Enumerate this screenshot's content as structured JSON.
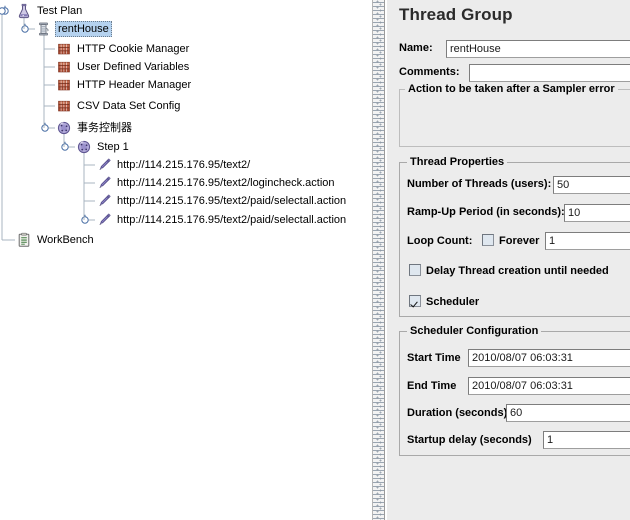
{
  "app": {
    "tree_panel_name": "test-plan-tree",
    "properties_panel_name": "thread-group-properties"
  },
  "tree": {
    "nodes": [
      {
        "label": "Test Plan",
        "icon": "test-plan-flask-icon",
        "depth": 0,
        "selected": false,
        "expanded": true,
        "name": "tree-node-test-plan"
      },
      {
        "label": "rentHouse",
        "icon": "thread-group-spool-icon",
        "depth": 1,
        "selected": true,
        "expanded": true,
        "name": "tree-node-rent-house"
      },
      {
        "label": "HTTP Cookie Manager",
        "icon": "config-element-icon",
        "depth": 2,
        "selected": false,
        "expanded": false,
        "name": "tree-node-http-cookie-manager"
      },
      {
        "label": "User Defined Variables",
        "icon": "config-element-icon",
        "depth": 2,
        "selected": false,
        "expanded": false,
        "name": "tree-node-user-defined-variables"
      },
      {
        "label": "HTTP Header Manager",
        "icon": "config-element-icon",
        "depth": 2,
        "selected": false,
        "expanded": false,
        "name": "tree-node-http-header-manager"
      },
      {
        "label": "CSV Data Set Config",
        "icon": "config-element-icon",
        "depth": 2,
        "selected": false,
        "expanded": false,
        "name": "tree-node-csv-data-set-config"
      },
      {
        "label": "事务控制器",
        "icon": "transaction-controller-icon",
        "depth": 2,
        "selected": false,
        "expanded": true,
        "name": "tree-node-transaction-controller"
      },
      {
        "label": "Step 1",
        "icon": "transaction-controller-icon",
        "depth": 3,
        "selected": false,
        "expanded": true,
        "name": "tree-node-step-1"
      },
      {
        "label": "http://114.215.176.95/text2/",
        "icon": "http-sampler-pen-icon",
        "depth": 4,
        "selected": false,
        "expanded": false,
        "name": "tree-node-sampler-root"
      },
      {
        "label": "http://114.215.176.95/text2/logincheck.action",
        "icon": "http-sampler-pen-icon",
        "depth": 4,
        "selected": false,
        "expanded": false,
        "name": "tree-node-sampler-logincheck"
      },
      {
        "label": "http://114.215.176.95/text2/paid/selectall.action",
        "icon": "http-sampler-pen-icon",
        "depth": 4,
        "selected": false,
        "expanded": false,
        "name": "tree-node-sampler-selectall-1"
      },
      {
        "label": "http://114.215.176.95/text2/paid/selectall.action",
        "icon": "http-sampler-pen-icon",
        "depth": 4,
        "selected": false,
        "expanded": true,
        "name": "tree-node-sampler-selectall-2"
      },
      {
        "label": "WorkBench",
        "icon": "workbench-clipboard-icon",
        "depth": 0,
        "selected": false,
        "expanded": false,
        "name": "tree-node-workbench"
      }
    ]
  },
  "properties": {
    "title": "Thread Group",
    "name_label": "Name:",
    "name_value": "rentHouse",
    "comments_label": "Comments:",
    "comments_value": "",
    "sampler_error_title": "Action to be taken after a Sampler error",
    "thread_properties": {
      "title": "Thread Properties",
      "num_threads_label": "Number of Threads (users):",
      "num_threads_value": "50",
      "ramp_up_label": "Ramp-Up Period (in seconds):",
      "ramp_up_value": "10",
      "loop_count_label": "Loop Count:",
      "forever_label": "Forever",
      "forever_checked": false,
      "loop_count_value": "1",
      "delay_thread_label": "Delay Thread creation until needed",
      "delay_thread_checked": false,
      "scheduler_label": "Scheduler",
      "scheduler_checked": true
    },
    "scheduler_configuration": {
      "title": "Scheduler Configuration",
      "start_time_label": "Start Time",
      "start_time_value": "2010/08/07 06:03:31",
      "end_time_label": "End Time",
      "end_time_value": "2010/08/07 06:03:31",
      "duration_label": "Duration (seconds)",
      "duration_value": "60",
      "startup_delay_label": "Startup delay (seconds)",
      "startup_delay_value": "1"
    }
  },
  "colors": {
    "selection": "#b5d2ef",
    "panel_bg": "#ececec",
    "tree_bg": "#ffffff",
    "tree_line": "#a8b4c0",
    "sampler_icon": "#8b82c4",
    "controller_icon": "#b0a8d8",
    "config_icon": "#b5553c"
  }
}
